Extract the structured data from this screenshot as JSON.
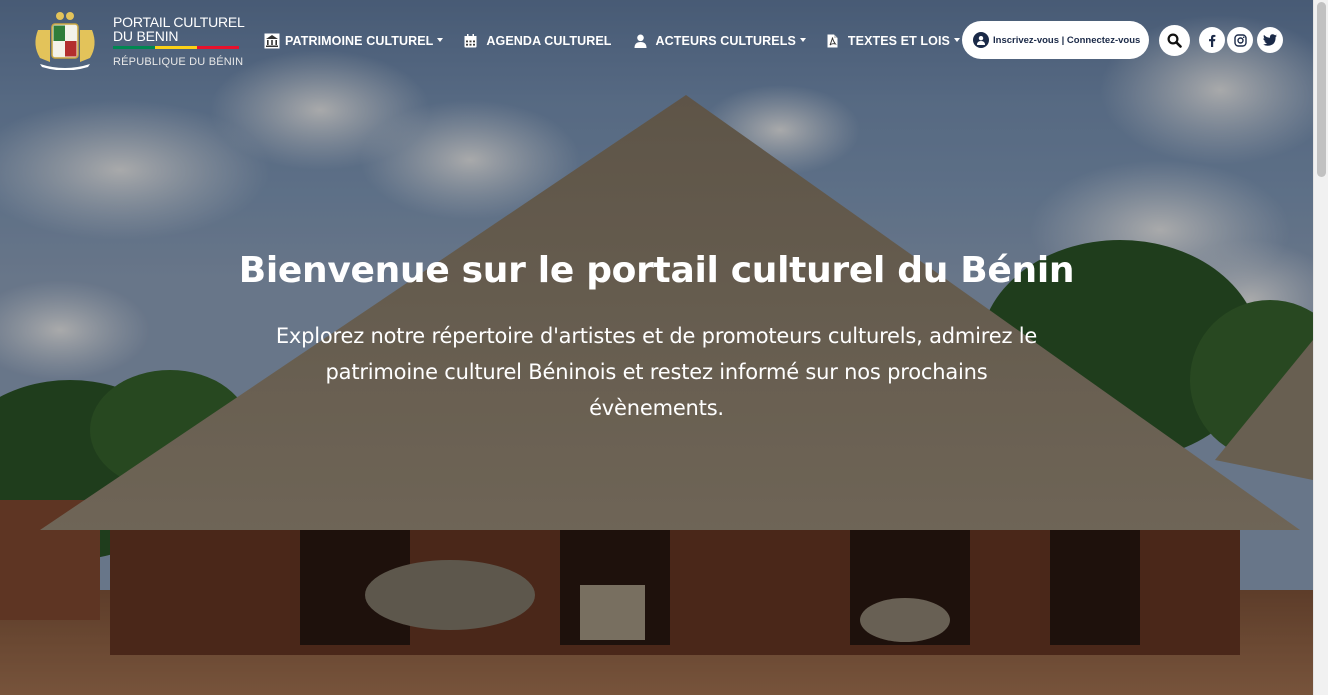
{
  "logo": {
    "line1": "PORTAIL CULTUREL",
    "line2": "DU BENIN",
    "line3": "RÉPUBLIQUE DU BÉNIN",
    "flag_colors": [
      "#008751",
      "#fcd116",
      "#e8112d"
    ]
  },
  "nav": {
    "items": [
      {
        "label": "PATRIMOINE CULTUREL",
        "icon": "monument-icon",
        "dropdown": true
      },
      {
        "label": "AGENDA CULTUREL",
        "icon": "calendar-icon",
        "dropdown": false
      },
      {
        "label": "ACTEURS CULTURELS",
        "icon": "user-icon",
        "dropdown": true
      },
      {
        "label": "TEXTES ET LOIS",
        "icon": "pdf-file-icon",
        "dropdown": true
      }
    ]
  },
  "auth": {
    "label": "Inscrivez-vous | Connectez-vous",
    "icon": "user-circle-icon"
  },
  "actions": {
    "search_icon": "search-icon",
    "social": [
      "facebook-icon",
      "instagram-icon",
      "twitter-icon"
    ]
  },
  "hero": {
    "title": "Bienvenue sur le portail culturel du Bénin",
    "subtitle": "Explorez notre répertoire d'artistes et de promoteurs culturels, admirez le patrimoine culturel Béninois et restez informé sur nos prochains évènements."
  },
  "colors": {
    "navy": "#1b2a48",
    "white": "#ffffff"
  }
}
